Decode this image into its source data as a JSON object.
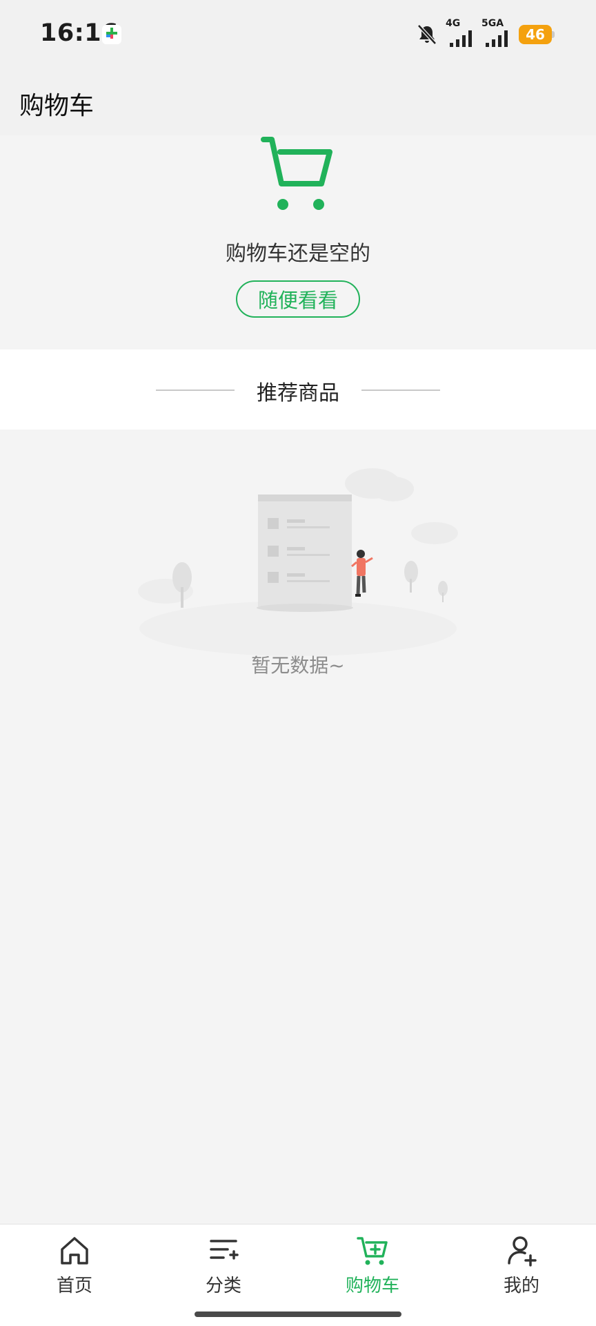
{
  "status_bar": {
    "time": "16:16",
    "network_1": "4G",
    "network_2": "5GA",
    "battery": "46",
    "icons": [
      "app-badge-icon",
      "mute-bell-icon",
      "signal-icon",
      "signal-icon",
      "battery-icon"
    ]
  },
  "header": {
    "title": "购物车"
  },
  "empty_cart": {
    "icon": "shopping-cart-icon",
    "message": "购物车还是空的",
    "button_label": "随便看看"
  },
  "recommend": {
    "title": "推荐商品"
  },
  "no_data": {
    "message": "暂无数据~",
    "illustration": "empty-state-illustration"
  },
  "bottom_nav": {
    "items": [
      {
        "label": "首页",
        "icon": "home-icon",
        "active": false
      },
      {
        "label": "分类",
        "icon": "category-list-icon",
        "active": false
      },
      {
        "label": "购物车",
        "icon": "cart-add-icon",
        "active": true
      },
      {
        "label": "我的",
        "icon": "user-add-icon",
        "active": false
      }
    ]
  },
  "colors": {
    "accent": "#21b25a",
    "battery": "#f4a10f",
    "background": "#f4f4f4"
  }
}
